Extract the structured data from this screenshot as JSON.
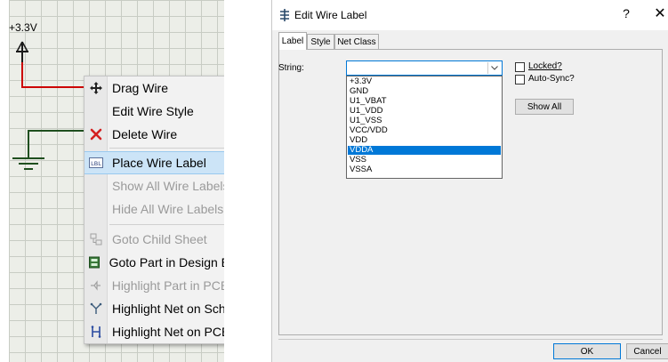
{
  "schematic": {
    "power_label": "+3.3V"
  },
  "context_menu": {
    "items": [
      {
        "label": "Drag Wire",
        "icon": "move-arrows-icon",
        "enabled": true
      },
      {
        "label": "Edit Wire Style",
        "icon": "",
        "enabled": true
      },
      {
        "label": "Delete Wire",
        "icon": "red-x-icon",
        "enabled": true
      },
      {
        "label": "Place Wire Label",
        "icon": "lbl-icon",
        "enabled": true,
        "highlighted": true
      },
      {
        "label": "Show All Wire Labels",
        "icon": "",
        "enabled": false
      },
      {
        "label": "Hide All Wire Labels",
        "icon": "",
        "enabled": false
      },
      {
        "label": "Goto Child Sheet",
        "icon": "child-sheet-icon",
        "enabled": false
      },
      {
        "label": "Goto Part in Design Ex",
        "icon": "design-explorer-icon",
        "enabled": true
      },
      {
        "label": "Highlight Part in PCB I",
        "icon": "highlight-part-icon",
        "enabled": false
      },
      {
        "label": "Highlight Net on Sche",
        "icon": "net-schematic-icon",
        "enabled": true
      },
      {
        "label": "Highlight Net on PCB",
        "icon": "net-pcb-icon",
        "enabled": true
      }
    ]
  },
  "dialog": {
    "title": "Edit Wire Label",
    "help_glyph": "?",
    "close_glyph": "✕",
    "tabs": [
      {
        "label": "Label",
        "active": true
      },
      {
        "label": "Style",
        "active": false
      },
      {
        "label": "Net Class",
        "active": false
      }
    ],
    "string_label": "String:",
    "string_value": "",
    "dropdown_options": [
      "+3.3V",
      "GND",
      "U1_VBAT",
      "U1_VDD",
      "U1_VSS",
      "VCC/VDD",
      "VDD",
      "VDDA",
      "VSS",
      "VSSA"
    ],
    "selected_option": "VDDA",
    "locked": {
      "label": "Locked?",
      "checked": false
    },
    "auto_sync": {
      "label": "Auto-Sync?",
      "checked": false
    },
    "show_all_label": "Show All",
    "ok_label": "OK",
    "cancel_label": "Cancel"
  },
  "colors": {
    "wire_red": "#cc0000",
    "wire_green": "#1f4f1f",
    "menu_highlight": "#cce4f7",
    "selection_blue": "#0078d7"
  }
}
